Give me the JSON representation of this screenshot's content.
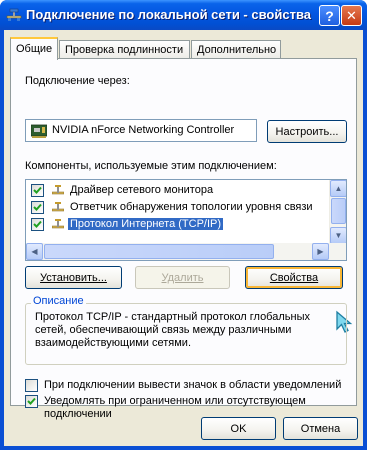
{
  "window": {
    "title": "Подключение по локальной сети - свойства",
    "help_label": "?",
    "close_label": "✕"
  },
  "tabs": [
    {
      "label": "Общие",
      "active": true
    },
    {
      "label": "Проверка подлинности",
      "active": false
    },
    {
      "label": "Дополнительно",
      "active": false
    }
  ],
  "connect_using": {
    "label": "Подключение через:",
    "adapter_name": "NVIDIA nForce Networking Controller",
    "configure_button": "Настроить..."
  },
  "components": {
    "label": "Компоненты, используемые этим подключением:",
    "items": [
      {
        "label": "Драйвер сетевого монитора",
        "checked": true,
        "selected": false
      },
      {
        "label": "Ответчик обнаружения топологии уровня связи",
        "checked": true,
        "selected": false
      },
      {
        "label": "Протокол Интернета (TCP/IP)",
        "checked": true,
        "selected": true
      }
    ]
  },
  "buttons": {
    "install": "Установить...",
    "uninstall": "Удалить",
    "properties": "Свойства",
    "ok": "OK",
    "cancel": "Отмена"
  },
  "description": {
    "title": "Описание",
    "text": "Протокол TCP/IP - стандартный протокол глобальных сетей, обеспечивающий связь между различными взаимодействующими сетями."
  },
  "options": [
    {
      "label": "При подключении вывести значок в области уведомлений",
      "checked": false
    },
    {
      "label_line1": "Уведомлять при ограниченном или отсутствующем",
      "label_line2": "подключении",
      "checked": true
    }
  ],
  "colors": {
    "title_bar": "#0054e3",
    "dialog_bg": "#ece9d8",
    "selection": "#316ac5",
    "group_title": "#0046d5",
    "tab_highlight": "#ffc83c"
  }
}
